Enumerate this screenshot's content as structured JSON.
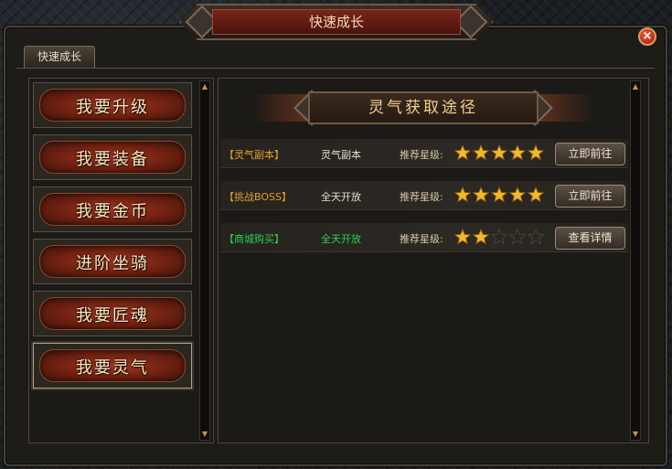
{
  "window": {
    "title": "快速成长",
    "close_glyph": "×"
  },
  "tabs": [
    {
      "label": "快速成长"
    }
  ],
  "nav": [
    {
      "label": "我要升级"
    },
    {
      "label": "我要装备"
    },
    {
      "label": "我要金币"
    },
    {
      "label": "进阶坐骑"
    },
    {
      "label": "我要匠魂"
    },
    {
      "label": "我要灵气",
      "active": true
    }
  ],
  "panel": {
    "title": "灵气获取途径",
    "rows": [
      {
        "source": "【灵气副本】",
        "source_color": "#e0a030",
        "availability": "灵气副本",
        "availability_color": "#e8dcc6",
        "rec_label": "推荐星级:",
        "stars": 5,
        "max_stars": 5,
        "button": "立即前往"
      },
      {
        "source": "【挑战BOSS】",
        "source_color": "#e0a030",
        "availability": "全天开放",
        "availability_color": "#e8dcc6",
        "rec_label": "推荐星级:",
        "stars": 5,
        "max_stars": 5,
        "button": "立即前往"
      },
      {
        "source": "【商城购买】",
        "source_color": "#2ecf52",
        "availability": "全天开放",
        "availability_color": "#2ecf52",
        "rec_label": "推荐星级:",
        "stars": 2,
        "max_stars": 5,
        "button": "查看详情"
      }
    ]
  },
  "colors": {
    "star_filled": "#f0b82a",
    "star_empty": "#2a2620",
    "accent_red": "#7a2418"
  },
  "icons": {
    "close": "close-icon",
    "scroll_up": "triangle-up-icon",
    "scroll_down": "triangle-down-icon",
    "star": "star-icon"
  }
}
